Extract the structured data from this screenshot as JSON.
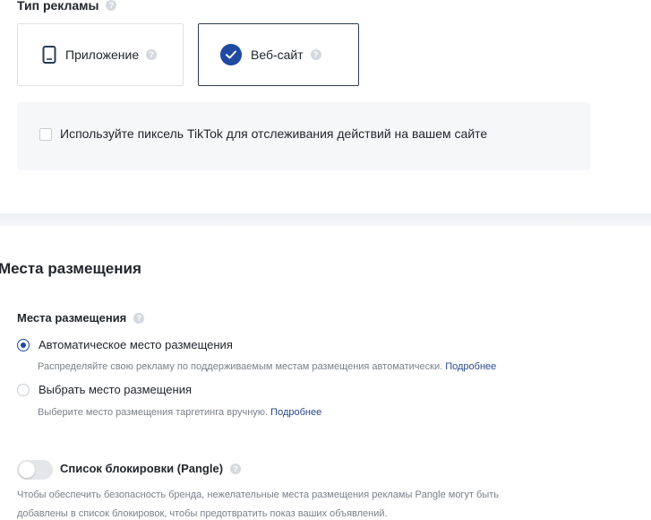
{
  "ad_type": {
    "title": "Тип рекламы",
    "help_icon": "?",
    "options": [
      {
        "label": "Приложение",
        "icon": "tablet-icon",
        "selected": false
      },
      {
        "label": "Веб-сайт",
        "icon": "check-circle-icon",
        "selected": true
      }
    ]
  },
  "pixel": {
    "label": "Используйте пиксель TikTok для отслеживания действий на вашем сайте",
    "checked": false
  },
  "placements_section": {
    "title": "Места размещения",
    "label": "Места размещения",
    "options": [
      {
        "label": "Автоматическое место размещения",
        "description": "Распределяйте свою рекламу по поддерживаемым местам размещения автоматически.",
        "link": "Подробнее",
        "selected": true
      },
      {
        "label": "Выбрать место размещения",
        "description": "Выберите место размещения таргетинга вручную.",
        "link": "Подробнее",
        "selected": false
      }
    ]
  },
  "blocklist": {
    "label": "Список блокировки (Pangle)",
    "enabled": false,
    "description_line1": "Чтобы обеспечить безопасность бренда, нежелательные места размещения рекламы Pangle могут быть",
    "description_line2": "добавлены в список блокировок, чтобы предотвратить показ ваших объявлений."
  },
  "colors": {
    "accent": "#1f4aa2",
    "link": "#2a4a8a",
    "selected_border": "#2a3e57"
  }
}
